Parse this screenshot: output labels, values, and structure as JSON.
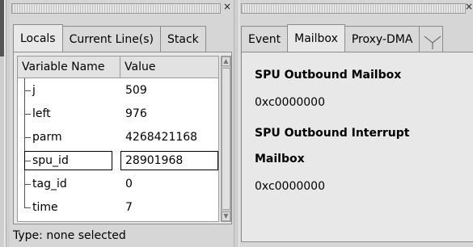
{
  "left_panel": {
    "close_glyph": "×",
    "tabs": [
      {
        "label": "Locals",
        "active": true
      },
      {
        "label": "Current Line(s)",
        "active": false
      },
      {
        "label": "Stack",
        "active": false
      }
    ],
    "columns": {
      "name": "Variable Name",
      "value": "Value"
    },
    "rows": [
      {
        "name": "j",
        "value": "509"
      },
      {
        "name": "left",
        "value": "976"
      },
      {
        "name": "parm",
        "value": "4268421168"
      },
      {
        "name": "spu_id",
        "value": "28901968"
      },
      {
        "name": "tag_id",
        "value": "0"
      },
      {
        "name": "time",
        "value": "7"
      }
    ],
    "status": "Type: none selected"
  },
  "right_panel": {
    "close_glyph": "×",
    "tabs": [
      {
        "label": "Event",
        "active": false
      },
      {
        "label": "Mailbox",
        "active": true
      },
      {
        "label": "Proxy-DMA",
        "active": false
      }
    ],
    "sections": [
      {
        "title": "SPU Outbound Mailbox",
        "value": "0xc0000000"
      },
      {
        "title_line1": "SPU Outbound Interrupt",
        "title_line2": "Mailbox",
        "value": "0xc0000000"
      }
    ]
  }
}
